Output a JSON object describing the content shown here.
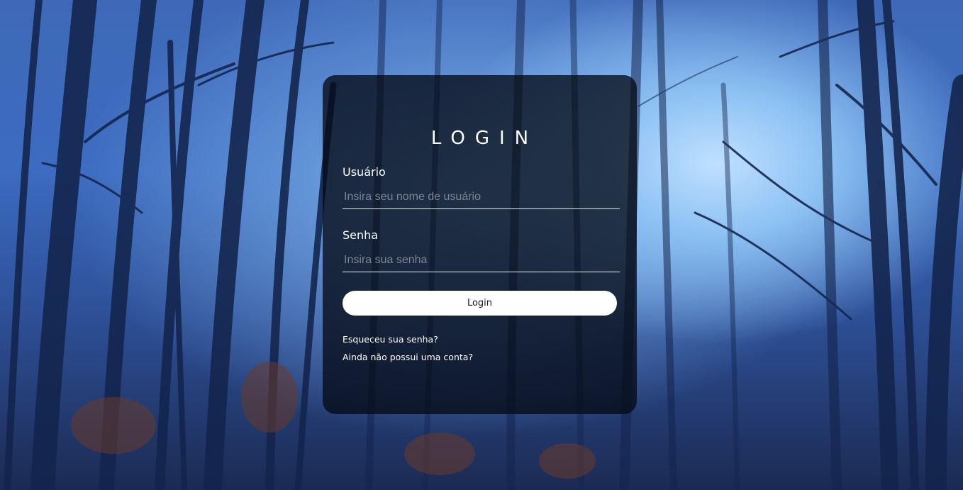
{
  "background": {
    "description_colors": {
      "sky": "#bfe0ff",
      "mid": "#3c6bc0",
      "dark": "#1b2a52",
      "trunks": "#0f1c3c"
    }
  },
  "login": {
    "title": "LOGIN",
    "username": {
      "label": "Usuário",
      "placeholder": "Insira seu nome de usuário",
      "value": ""
    },
    "password": {
      "label": "Senha",
      "placeholder": "Insira sua senha",
      "value": ""
    },
    "submit_label": "Login",
    "forgot_password_link": "Esqueceu sua senha?",
    "signup_link": "Ainda não possui uma conta?"
  },
  "colors": {
    "card_background": "rgba(5,10,22,0.78)",
    "text": "#ffffff",
    "button_background": "#ffffff",
    "button_text": "#1a1a1a"
  }
}
